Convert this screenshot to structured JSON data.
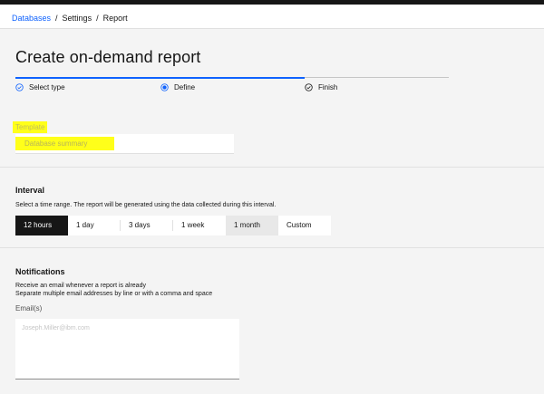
{
  "breadcrumb": {
    "items": [
      {
        "label": "Databases",
        "link": true
      },
      {
        "label": "Settings",
        "link": false
      },
      {
        "label": "Report",
        "link": false
      }
    ],
    "separator": "/"
  },
  "page": {
    "title": "Create on-demand report"
  },
  "progress": {
    "steps": [
      {
        "label": "Select type",
        "state": "complete",
        "icon": "checkmark-outline-icon"
      },
      {
        "label": "Define",
        "state": "current",
        "icon": "current-step-icon"
      },
      {
        "label": "Finish",
        "state": "complete",
        "icon": "checkmark-outline-icon"
      }
    ],
    "fill_fraction": 0.667
  },
  "template": {
    "label": "Template",
    "value": "Database summary"
  },
  "interval": {
    "title": "Interval",
    "helper": "Select a time range. The report will be generated using the data collected during this interval.",
    "options": [
      "12 hours",
      "1 day",
      "3 days",
      "1 week",
      "1 month",
      "Custom"
    ],
    "selected": "12 hours"
  },
  "notifications": {
    "title": "Notifications",
    "helper_line1": "Receive an email whenever a report is already",
    "helper_line2": "Separate multiple email addresses by line or with a comma and space",
    "email_label": "Email(s)",
    "email_placeholder": "Joseph.Miller@ibm.com"
  },
  "colors": {
    "accent": "#0f62fe",
    "highlight": "#ffff1a",
    "selected_tab": "#161616"
  }
}
